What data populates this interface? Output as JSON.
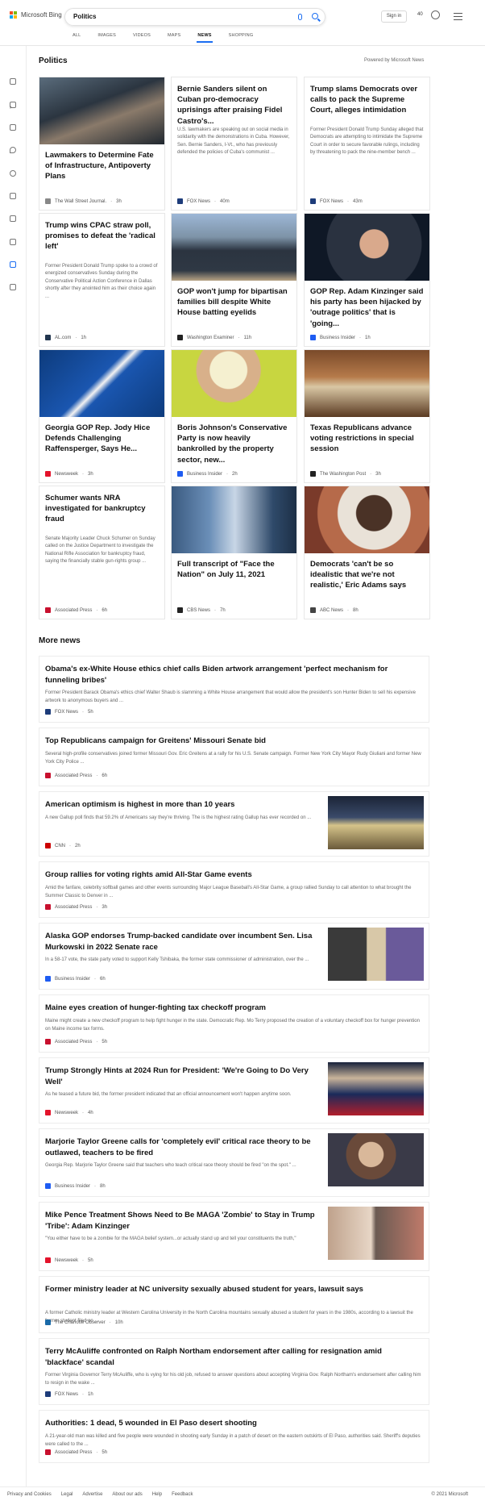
{
  "header": {
    "brand": "Microsoft Bing",
    "query": "Politics",
    "signin": "Sign in",
    "points": "40",
    "nav_tabs": [
      "ALL",
      "IMAGES",
      "VIDEOS",
      "MAPS",
      "NEWS",
      "SHOPPING"
    ],
    "active_tab": "NEWS"
  },
  "section": {
    "title": "Politics",
    "powered_by": "Powered by Microsoft News"
  },
  "cards": [
    {
      "title": "Lawmakers to Determine Fate of Infrastructure, Antipoverty Plans",
      "desc": "",
      "source": "The Wall Street Journal.",
      "time": "3h",
      "has_image": true
    },
    {
      "title": "Bernie Sanders silent on Cuban pro-democracy uprisings after praising Fidel Castro's...",
      "desc": "U.S. lawmakers are speaking out on social media in solidarity with the demonstrations in Cuba. However, Sen. Bernie Sanders, I-Vt., who has previously defended the policies of Cuba's communist ...",
      "source": "FOX News",
      "time": "40m",
      "has_image": false
    },
    {
      "title": "Trump slams Democrats over calls to pack the Supreme Court, alleges intimidation",
      "desc": "Former President Donald Trump Sunday alleged that Democrats are attempting to intimidate the Supreme Court in order to secure favorable rulings, including by threatening to pack the nine-member bench ...",
      "source": "FOX News",
      "time": "43m",
      "has_image": false
    },
    {
      "title": "Trump wins CPAC straw poll, promises to defeat the 'radical left'",
      "desc": "Former President Donald Trump spoke to a crowd of energized conservatives Sunday during the Conservative Political Action Conference in Dallas shortly after they anointed him as their choice again ...",
      "source": "AL.com",
      "time": "1h",
      "has_image": false
    },
    {
      "title": "GOP won't jump for bipartisan families bill despite White House batting eyelids",
      "desc": "",
      "source": "Washington Examiner",
      "time": "11h",
      "has_image": true
    },
    {
      "title": "GOP Rep. Adam Kinzinger said his party has been hijacked by 'outrage politics' that is 'going...",
      "desc": "",
      "source": "Business Insider",
      "time": "1h",
      "has_image": true
    },
    {
      "title": "Georgia GOP Rep. Jody Hice Defends Challenging Raffensperger, Says He...",
      "desc": "",
      "source": "Newsweek",
      "time": "3h",
      "has_image": true
    },
    {
      "title": "Boris Johnson's Conservative Party is now heavily bankrolled by the property sector, new...",
      "desc": "",
      "source": "Business Insider",
      "time": "2h",
      "has_image": true
    },
    {
      "title": "Texas Republicans advance voting restrictions in special session",
      "desc": "",
      "source": "The Washington Post",
      "time": "3h",
      "has_image": true
    },
    {
      "title": "Schumer wants NRA investigated for bankruptcy fraud",
      "desc": "Senate Majority Leader Chuck Schumer on Sunday called on the Justice Department to investigate the National Rifle Association for bankruptcy fraud, saying the financially stable gun-rights group ...",
      "source": "Associated Press",
      "time": "6h",
      "has_image": false
    },
    {
      "title": "Full transcript of \"Face the Nation\" on July 11, 2021",
      "desc": "",
      "source": "CBS News",
      "time": "7h",
      "has_image": true
    },
    {
      "title": "Democrats 'can't be so idealistic that we're not realistic,' Eric Adams says",
      "desc": "",
      "source": "ABC News",
      "time": "8h",
      "has_image": true
    }
  ],
  "more_news": {
    "title": "More news",
    "items": [
      {
        "title": "Obama's ex-White House ethics chief calls Biden artwork arrangement 'perfect mechanism for funneling bribes'",
        "desc": "Former President Barack Obama's ethics chief Walter Shaub is slamming a White House arrangement that would allow the president's son Hunter Biden to sell his expensive artwork to anonymous buyers and ...",
        "source": "FOX News",
        "time": "5h",
        "has_image": false
      },
      {
        "title": "Top Republicans campaign for Greitens' Missouri Senate bid",
        "desc": "Several high-profile conservatives joined former Missouri Gov. Eric Greitens at a rally for his U.S. Senate campaign. Former New York City Mayor Rudy Giuliani and former New York City Police ...",
        "source": "Associated Press",
        "time": "6h",
        "has_image": false
      },
      {
        "title": "American optimism is highest in more than 10 years",
        "desc": "A new Gallup poll finds that 59.2% of Americans say they're thriving. The is the highest rating Gallup has ever recorded on ...",
        "source": "CNN",
        "time": "2h",
        "has_image": true
      },
      {
        "title": "Group rallies for voting rights amid All-Star Game events",
        "desc": "Amid the fanfare, celebrity softball games and other events surrounding Major League Baseball's All-Star Game, a group rallied Sunday to call attention to what brought the Summer Classic to Denver in ...",
        "source": "Associated Press",
        "time": "3h",
        "has_image": false
      },
      {
        "title": "Alaska GOP endorses Trump-backed candidate over incumbent Sen. Lisa Murkowski in 2022 Senate race",
        "desc": "In a 58-17 vote, the state party voted to support Kelly Tshibaka, the former state commissioner of administration, over the ...",
        "source": "Business Insider",
        "time": "6h",
        "has_image": true
      },
      {
        "title": "Maine eyes creation of hunger-fighting tax checkoff program",
        "desc": "Maine might create a new checkoff program to help fight hunger in the state. Democratic Rep. Mo Terry proposed the creation of a voluntary checkoff box for hunger prevention on Maine income tax forms.",
        "source": "Associated Press",
        "time": "5h",
        "has_image": false
      },
      {
        "title": "Trump Strongly Hints at 2024 Run for President: 'We're Going to Do Very Well'",
        "desc": "As he teased a future bid, the former president indicated that an official announcement won't happen anytime soon.",
        "source": "Newsweek",
        "time": "4h",
        "has_image": true
      },
      {
        "title": "Marjorie Taylor Greene calls for 'completely evil' critical race theory to be outlawed, teachers to be fired",
        "desc": "Georgia Rep. Marjorie Taylor Greene said that teachers who teach critical race theory should be fired \"on the spot.\" ...",
        "source": "Business Insider",
        "time": "8h",
        "has_image": true
      },
      {
        "title": "Mike Pence Treatment Shows Need to Be MAGA 'Zombie' to Stay in Trump 'Tribe': Adam Kinzinger",
        "desc": "\"You either have to be a zombie for the MAGA belief system...or actually stand up and tell your constituents the truth,\"",
        "source": "Newsweek",
        "time": "5h",
        "has_image": true
      },
      {
        "title": "Former ministry leader at NC university sexually abused student for years, lawsuit says",
        "desc": "A former Catholic ministry leader at Western Carolina University in the North Carolina mountains sexually abused a student for years in the 1980s, according to a lawsuit the former student filed on ...",
        "source": "The Charlotte Observer",
        "time": "10h",
        "has_image": false
      },
      {
        "title": "Terry McAuliffe confronted on Ralph Northam endorsement after calling for resignation amid 'blackface' scandal",
        "desc": "Former Virginia Governor Terry McAuliffe, who is vying for his old job, refused to answer questions about accepting Virginia Gov. Ralph Northam's endorsement after calling him to resign in the wake ...",
        "source": "FOX News",
        "time": "1h",
        "has_image": false
      },
      {
        "title": "Authorities: 1 dead, 5 wounded in El Paso desert shooting",
        "desc": "A 21-year-old man was killed and five people were wounded in shooting early Sunday in a patch of desert on the eastern outskirts of El Paso, authorities said. Sheriff's deputies were called to the ...",
        "source": "Associated Press",
        "time": "5h",
        "has_image": false
      }
    ]
  },
  "footer": {
    "links": [
      "Privacy and Cookies",
      "Legal",
      "Advertise",
      "About our ads",
      "Help",
      "Feedback"
    ],
    "copyright": "© 2021 Microsoft"
  },
  "colors": {
    "accent": "#1b6ef2",
    "fox": "#1d3c7a",
    "ap": "#c8102e",
    "newsweek": "#e3132b",
    "cnn": "#cc0000",
    "bi": "#1e5cf2"
  },
  "icons": [
    "search-icon",
    "microphone-icon",
    "rewards-icon",
    "hamburger-menu-icon",
    "chevron-right-icon",
    "home-icon",
    "trending-icon",
    "flag-icon",
    "location-icon",
    "globe-icon",
    "sports-icon",
    "rocket-icon",
    "entertainment-icon",
    "money-icon",
    "car-icon"
  ]
}
